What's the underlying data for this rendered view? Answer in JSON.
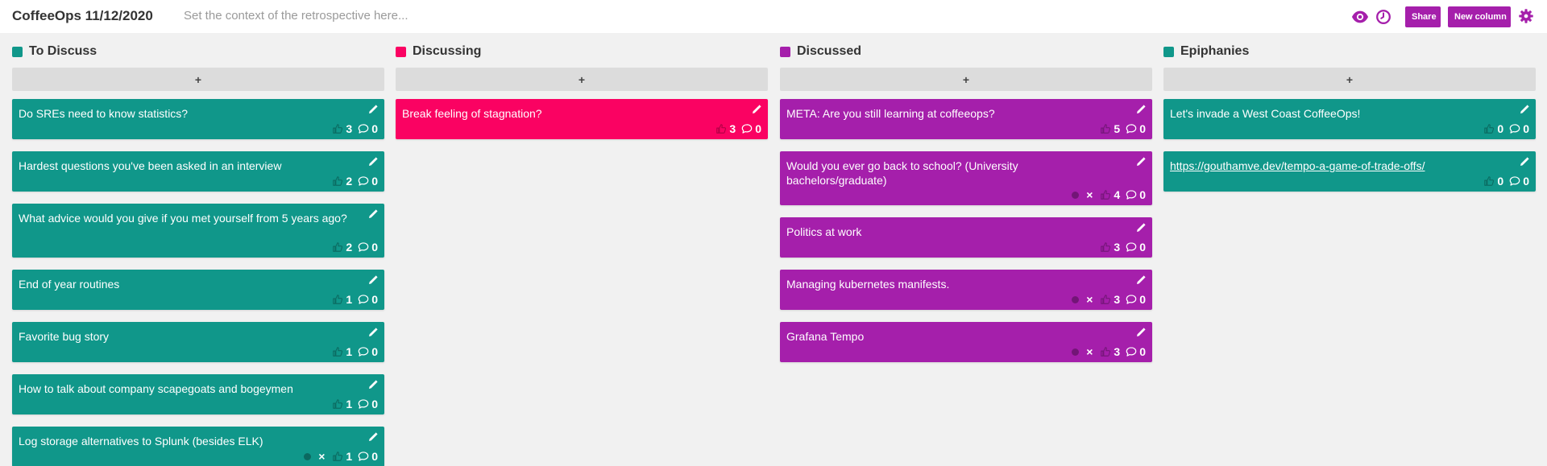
{
  "header": {
    "title": "CoffeeOps 11/12/2020",
    "context_placeholder": "Set the context of the retrospective here...",
    "share_label": "Share",
    "new_column_label": "New column",
    "icons": [
      "eye-icon",
      "clock-icon",
      "gear-icon"
    ],
    "accent": "#a51fab"
  },
  "columns": [
    {
      "title": "To Discuss",
      "color": "#10978a",
      "add_label": "+",
      "cards": [
        {
          "text": "Do SREs need to know statistics?",
          "votes": "3",
          "comments": "0"
        },
        {
          "text": "Hardest questions you've been asked in an interview",
          "votes": "2",
          "comments": "0"
        },
        {
          "text": "What advice would you give if you met yourself from 5 years ago?",
          "votes": "2",
          "comments": "0"
        },
        {
          "text": "End of year routines",
          "votes": "1",
          "comments": "0"
        },
        {
          "text": "Favorite bug story",
          "votes": "1",
          "comments": "0"
        },
        {
          "text": "How to talk about company scapegoats and bogeymen",
          "votes": "1",
          "comments": "0"
        },
        {
          "text": "Log storage alternatives to Splunk (besides ELK)",
          "votes": "1",
          "comments": "0",
          "remove": "×"
        }
      ]
    },
    {
      "title": "Discussing",
      "color": "#fa0262",
      "add_label": "+",
      "cards": [
        {
          "text": "Break feeling of stagnation?",
          "votes": "3",
          "comments": "0"
        }
      ]
    },
    {
      "title": "Discussed",
      "color": "#a51fab",
      "add_label": "+",
      "cards": [
        {
          "text": "META: Are you still learning at coffeeops?",
          "votes": "5",
          "comments": "0"
        },
        {
          "text": "Would you ever go back to school? (University bachelors/graduate)",
          "votes": "4",
          "comments": "0",
          "remove": "×"
        },
        {
          "text": "Politics at work",
          "votes": "3",
          "comments": "0"
        },
        {
          "text": "Managing kubernetes manifests.",
          "votes": "3",
          "comments": "0",
          "remove": "×"
        },
        {
          "text": "Grafana Tempo",
          "votes": "3",
          "comments": "0",
          "remove": "×"
        }
      ]
    },
    {
      "title": "Epiphanies",
      "color": "#10978a",
      "add_label": "+",
      "cards": [
        {
          "text": "Let's invade a West Coast CoffeeOps!",
          "votes": "0",
          "comments": "0"
        },
        {
          "text": "https://gouthamve.dev/tempo-a-game-of-trade-offs/",
          "votes": "0",
          "comments": "0"
        }
      ]
    }
  ]
}
